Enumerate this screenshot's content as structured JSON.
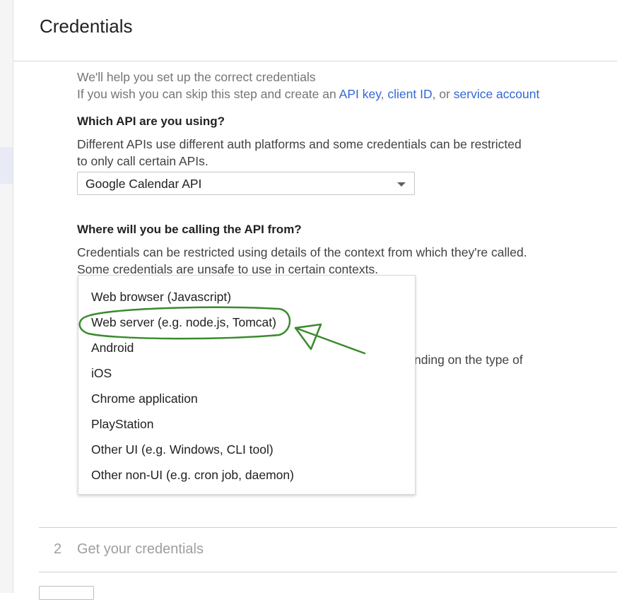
{
  "page": {
    "title": "Credentials"
  },
  "intro": {
    "line1": "We'll help you set up the correct credentials",
    "line2_prefix": "If you wish you can skip this step and create an ",
    "link_api_key": "API key",
    "sep1": ", ",
    "link_client_id": "client ID",
    "sep2": ", or ",
    "link_service_account": "service account"
  },
  "api_section": {
    "heading": "Which API are you using?",
    "description": "Different APIs use different auth platforms and some credentials can be restricted to only call certain APIs.",
    "selected": "Google Calendar API"
  },
  "calling_section": {
    "heading": "Where will you be calling the API from?",
    "description": "Credentials can be restricted using details of the context from which they're called. Some credentials are unsafe to use in certain contexts.",
    "obscured_text": "nding on the type of",
    "options": [
      "Web browser (Javascript)",
      "Web server (e.g. node.js, Tomcat)",
      "Android",
      "iOS",
      "Chrome application",
      "PlayStation",
      "Other UI (e.g. Windows, CLI tool)",
      "Other non-UI (e.g. cron job, daemon)"
    ]
  },
  "annotation": {
    "color": "#3a8a2e",
    "target": "Web server (e.g. node.js, Tomcat)"
  },
  "step2": {
    "number": "2",
    "title": "Get your credentials"
  },
  "colors": {
    "link": "#3367d6",
    "muted": "#9e9e9e"
  }
}
